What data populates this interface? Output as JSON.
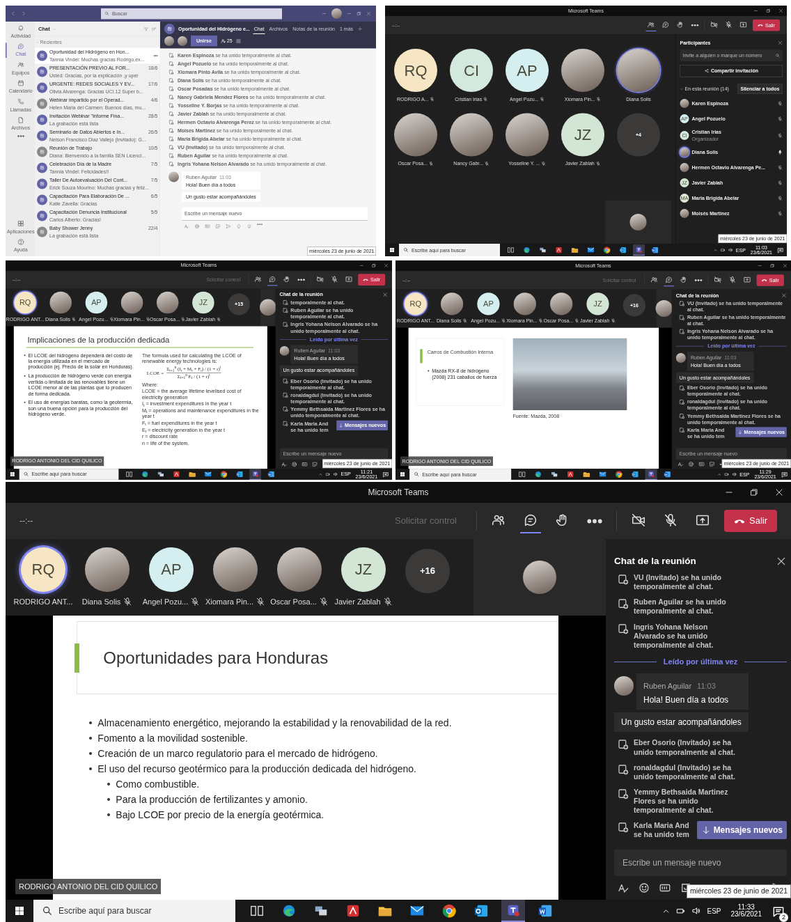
{
  "panels": [
    {
      "kind": "chat_app",
      "search_placeholder": "Buscar",
      "rail": [
        {
          "label": "Actividad",
          "selected": false
        },
        {
          "label": "Chat",
          "selected": true
        },
        {
          "label": "Equipos",
          "selected": false
        },
        {
          "label": "Calendario",
          "selected": false
        },
        {
          "label": "Llamadas",
          "selected": false
        },
        {
          "label": "Archivos",
          "selected": false
        },
        {
          "selected": false
        }
      ],
      "rail_bottom": [
        {
          "label": "Aplicaciones"
        },
        {
          "label": "Ayuda"
        }
      ],
      "list_title": "Chat",
      "section": "Recientes",
      "chats": [
        {
          "title": "Oportunidad del Hidrógeno en Hon...",
          "preview": "Tannia Vindel: Muchas gracias Rodrigo,ex...",
          "color": "#6264a7",
          "selected": true
        },
        {
          "title": "PRESENTACIÓN PREVIO AL FOR...",
          "date": "18/6",
          "preview": "Usted: Gracias, por la explicación ,y uper",
          "color": "#6264a7",
          "selected": false
        },
        {
          "title": "URGENTE: REDES SOCIALES Y EV...",
          "date": "17/6",
          "preview": "Olivia Alvarenga: Gracias UCI.12 Super b...",
          "color": "#6264a7",
          "selected": false
        },
        {
          "title": "Webinar impartido por el Operad...",
          "date": "4/6",
          "preview": "Helen Maria del Carmen: Buenos días, mu...",
          "color": "#8a8886",
          "selected": false
        },
        {
          "title": "Invitación Webinar \"Informe Fina...",
          "date": "28/5",
          "preview": "La grabación está lista",
          "color": "#6264a7",
          "selected": false
        },
        {
          "title": "Seminario de Datos Abiertos e In...",
          "date": "26/5",
          "preview": "Nelson Francisco Diaz Vallejo (Invitado): G...",
          "color": "#6264a7",
          "selected": false
        },
        {
          "title": "Reunión de Trabajo",
          "date": "10/5",
          "preview": "Diana: Bienvenido a la familia SEN Licenci...",
          "color": "#8a8886",
          "selected": false
        },
        {
          "title": "Celebración Día de la Madre",
          "date": "7/5",
          "preview": "Tannia Vindel: Felicidades!!",
          "color": "#6264a7",
          "selected": false
        },
        {
          "title": "Taller De Autoevaluación Del Cont...",
          "date": "7/5",
          "preview": "Erick Souza Mourino: Muchas gracias y feliz...",
          "color": "#6264a7",
          "selected": false
        },
        {
          "title": "Capacitación Para Elaboración De ...",
          "date": "6/5",
          "preview": "Katie Zavella: Gracias",
          "color": "#6264a7",
          "selected": false
        },
        {
          "title": "Capacitación Denuncia Institucional",
          "date": "5/5",
          "preview": "Carlos Alberto: Gracias!",
          "color": "#6264a7",
          "selected": false
        },
        {
          "title": "Baby Shower Jenny",
          "date": "22/4",
          "preview": "La grabación está lista",
          "color": "#8a8886",
          "selected": false
        }
      ],
      "conversation": {
        "title": "Oportunidad del Hidrógeno e...",
        "tabs": [
          {
            "label": "Chat",
            "selected": true
          },
          {
            "label": "Archivos",
            "selected": false
          },
          {
            "label": "Notas de la reunión",
            "selected": false
          },
          {
            "label": "1 más",
            "selected": false
          }
        ],
        "join_button": "Unirse",
        "participant_count": "25",
        "events": [
          "**Karen Espinoza** se ha unido temporalmente al chat.",
          "**Angel Pozuelo** se ha unido temporalmente al chat.",
          "**Xiomara Pinto Avila** se ha unido temporalmente al chat.",
          "**Diana Solis** se ha unido temporalmente al chat.",
          "**Oscar Posadas** se ha unido temporalmente al chat.",
          "**Nancy Gabriela Mendez Flores** se ha unido temporalmente al chat.",
          "**Yosseline Y. Borjas** se ha unido temporalmente al chat.",
          "**Javier Zablah** se ha unido temporalmente al chat.",
          "**Hermen Octavio Alvarenga Perez** se ha unido temporalmente al chat.",
          "**Moisés Martinez** se ha unido temporalmente al chat.",
          "**Maria Brigida Abelar** se ha unido temporalmente al chat.",
          "**VU (Invitado)** se ha unido temporalmente al chat.",
          "**Ruben Aguilar** se ha unido temporalmente al chat.",
          "**Ingris Yohana Nelson Alvarado** se ha unido temporalmente al chat."
        ],
        "message": {
          "author": "Ruben Aguilar",
          "time": "11:03",
          "texts": [
            "Hola! Buen día a todos",
            "Un gusto estar acompañándoles"
          ]
        },
        "compose_placeholder": "Escribe un mensaje nuevo"
      },
      "tooltip": "miércoles 23 de junio de 2021"
    },
    {
      "kind": "gallery",
      "title": "Microsoft Teams",
      "timer": "--:--",
      "toolbar": [
        {
          "kind": "participants",
          "selected": true
        },
        {
          "kind": "chat",
          "selected": false
        },
        {
          "kind": "reactions",
          "selected": false
        },
        {
          "kind": "more",
          "selected": false
        }
      ],
      "leave_button": "Salir",
      "tiles": [
        {
          "kind": "initials",
          "initials": "RQ",
          "color": "#f7e6c4",
          "name": "RODRIGO A...",
          "muted": true,
          "speaking": false
        },
        {
          "kind": "initials",
          "initials": "CI",
          "color": "#d3e9dd",
          "name": "Cristian Irias",
          "muted": true,
          "speaking": false
        },
        {
          "kind": "initials",
          "initials": "AP",
          "color": "#d5eff0",
          "name": "Angel Pozu...",
          "muted": true,
          "speaking": false
        },
        {
          "kind": "photo",
          "name": "Xiomara Pin...",
          "muted": true,
          "speaking": false
        },
        {
          "kind": "photo",
          "name": "Diana Solis",
          "muted": false,
          "speaking": true
        },
        {
          "kind": "photo",
          "name": "Oscar Posa...",
          "muted": true,
          "speaking": false
        },
        {
          "kind": "photo",
          "name": "Nancy Gabr...",
          "muted": true,
          "speaking": false
        },
        {
          "kind": "photo",
          "name": "Yosseline Y. ...",
          "muted": true,
          "speaking": false
        },
        {
          "kind": "initials",
          "initials": "JZ",
          "color": "#d3e6d6",
          "name": "Javier Zablah",
          "muted": true,
          "speaking": false
        },
        {
          "kind": "overflow",
          "label": "+4"
        }
      ],
      "participants": {
        "title": "Participantes",
        "search_placeholder": "Invite a alguien o marque un número",
        "share_button": "Compartir invitación",
        "section": "En esta reunión (14)",
        "mute_all": "Silenciar a todos",
        "people": [
          {
            "kind": "photo",
            "name": "Karen Espinoza",
            "muted": true,
            "speaking": false
          },
          {
            "kind": "initials",
            "initials": "AP",
            "color": "#d5eff0",
            "name": "Angel Pozuelo",
            "muted": true,
            "speaking": false
          },
          {
            "kind": "initials",
            "initials": "CI",
            "color": "#d3e9dd",
            "name": "Cristian Irias",
            "role": "Organizador",
            "muted": true,
            "speaking": false
          },
          {
            "kind": "photo",
            "name": "Diana Solis",
            "muted": false,
            "speaking": true
          },
          {
            "kind": "photo",
            "name": "Hermen Octavio Alvarenga Pe...",
            "muted": true,
            "speaking": false
          },
          {
            "kind": "initials",
            "initials": "JZ",
            "color": "#d3e6d6",
            "name": "Javier Zablah",
            "muted": true,
            "speaking": false
          },
          {
            "kind": "initials",
            "initials": "MA",
            "color": "#dfe8d4",
            "name": "Maria Brigida Abelar",
            "muted": true,
            "speaking": false
          },
          {
            "kind": "photo",
            "name": "Moisés Martinez",
            "muted": true,
            "speaking": false
          }
        ]
      },
      "tooltip": "miércoles 23 de junio de 2021",
      "taskbar": {
        "search_placeholder": "Escribe aquí para buscar",
        "language": "ESP",
        "time": "11:03",
        "date": "23/6/2021"
      }
    },
    {
      "kind": "presentation",
      "title": "Microsoft Teams",
      "timer": "--:--",
      "request_control": "Solicitar control",
      "toolbar": [
        {
          "kind": "participants",
          "selected": false
        },
        {
          "kind": "chat",
          "selected": true
        },
        {
          "kind": "reactions",
          "selected": false
        },
        {
          "kind": "more",
          "selected": false
        }
      ],
      "leave_button": "Salir",
      "strip": [
        {
          "kind": "initials",
          "initials": "RQ",
          "color": "#f7e6c4",
          "name": "RODRIGO ANT...",
          "muted": false,
          "speaking": true
        },
        {
          "kind": "photo",
          "name": "Diana Solis",
          "muted": true,
          "speaking": false
        },
        {
          "kind": "initials",
          "initials": "AP",
          "color": "#d5eff0",
          "name": "Angel Pozu...",
          "muted": true,
          "speaking": false
        },
        {
          "kind": "photo",
          "name": "Xiomara Pin...",
          "muted": true,
          "speaking": false
        },
        {
          "kind": "photo",
          "name": "Oscar Posa...",
          "muted": true,
          "speaking": false
        },
        {
          "kind": "initials",
          "initials": "JZ",
          "color": "#d3e6d6",
          "name": "Javier Zablah",
          "muted": true,
          "speaking": false
        },
        {
          "kind": "overflow",
          "label": "+15"
        }
      ],
      "slide": {
        "kind": "formula",
        "title": "Implicaciones de la producción dedicada",
        "bullets": [
          {
            "text": "El LCOE del hidrógeno dependerá del costo de la energía utilizada en el mercado de producción (ej. Precio de la solar en Honduras)."
          },
          {
            "text": "La producción de hidrógeno verde con energía vertida o limitada de las renovables tiene un LCOE menor al de las plantas que lo producen de forma dedicada."
          },
          {
            "text": "El uso de energías baratas, como la geotermia, son una buena opción para la producción del hidrógeno verde."
          }
        ],
        "formula": {
          "intro": "The formula used for calculating the LCOE of renewable energy technologies is:",
          "lhs": "LCOE =",
          "numerator": "Σ$_{t=1}$$^{n}$ (I$_{t}$ + M$_{t}$ + F$_{t}$) / (1 + r)$^{t}$",
          "denominator": "Σ$_{t=1}$$^{n}$ E$_{t}$ / (1 + r)$^{t}$",
          "where": "Where:",
          "definitions": [
            "LCOE = the average lifetime levelised cost of electricity generation",
            "I$_{t}$ = investment expenditures in the year t",
            "M$_{t}$ = operations and maintenance expenditures in the year t",
            "F$_{t}$ = fuel expenditures in the year t",
            "E$_{t}$ = electricity generation in the year t",
            "r = discount rate",
            "n = life of the system."
          ]
        }
      },
      "presenter": "RODRIGO ANTONIO DEL CID QUILICO",
      "chat": {
        "title": "Chat de la reunión",
        "items": [
          {
            "kind": "system",
            "text": "temporalmente al chat."
          },
          {
            "kind": "system",
            "text": "Ruben Aguilar se ha unido temporalmente al chat."
          },
          {
            "kind": "system",
            "text": "Ingris Yohana Nelson Alvarado se ha unido temporalmente al chat."
          },
          {
            "kind": "divider",
            "text": "Leído por última vez"
          },
          {
            "kind": "message",
            "author": "Ruben Aguilar",
            "time": "11:03",
            "texts": [
              "Hola! Buen día a todos",
              "Un gusto estar acompañándoles"
            ]
          },
          {
            "kind": "system",
            "text": "Eber Osorio (Invitado) se ha unido temporalmente al chat."
          },
          {
            "kind": "system",
            "text": "ronaldagdul (Invitado) se ha unido temporalmente al chat."
          },
          {
            "kind": "system",
            "text": "Yemmy Bethsaida Martinez Flores se ha unido temporalmente al chat."
          },
          {
            "kind": "system",
            "text": "Karla Maria And se ha unido tem"
          }
        ],
        "new_messages": "Mensajes nuevos",
        "compose_placeholder": "Escribe un mensaje nuevo"
      },
      "tooltip": "miércoles 23 de junio de 2021",
      "taskbar": {
        "search_placeholder": "Escribe aquí para buscar",
        "language": "ESP",
        "time": "11:21",
        "date": "23/6/2021"
      }
    },
    {
      "kind": "presentation",
      "title": "Microsoft Teams",
      "timer": "--:--",
      "request_control": "Solicitar control",
      "toolbar": [
        {
          "kind": "participants",
          "selected": false
        },
        {
          "kind": "chat",
          "selected": true
        },
        {
          "kind": "reactions",
          "selected": false
        },
        {
          "kind": "more",
          "selected": false
        }
      ],
      "leave_button": "Salir",
      "strip": [
        {
          "kind": "initials",
          "initials": "RQ",
          "color": "#f7e6c4",
          "name": "RODRIGO ANT...",
          "muted": false,
          "speaking": true
        },
        {
          "kind": "photo",
          "name": "Diana Solis",
          "muted": true,
          "speaking": false
        },
        {
          "kind": "initials",
          "initials": "AP",
          "color": "#d5eff0",
          "name": "Angel Pozu...",
          "muted": true,
          "speaking": false
        },
        {
          "kind": "photo",
          "name": "Xiomara Pin...",
          "muted": true,
          "speaking": false
        },
        {
          "kind": "photo",
          "name": "Oscar Posa...",
          "muted": true,
          "speaking": false
        },
        {
          "kind": "initials",
          "initials": "JZ",
          "color": "#d3e6d6",
          "name": "Javier Zablah",
          "muted": true,
          "speaking": false
        },
        {
          "kind": "overflow",
          "label": "+16"
        }
      ],
      "slide": {
        "kind": "photo",
        "title": "Carros de Combustión Interna",
        "bullets": [
          {
            "text": "Mazda RX-8 de hidrógeno (2008) 231 caballos de fuerza"
          }
        ],
        "caption": "Fuente: Mazda, 2008"
      },
      "presenter": "RODRIGO ANTONIO DEL CID QUILICO",
      "chat": {
        "title": "Chat de la reunión",
        "items": [
          {
            "kind": "system",
            "text": "VU (Invitado) se ha unido temporalmente al chat."
          },
          {
            "kind": "system",
            "text": "Ruben Aguilar se ha unido temporalmente al chat."
          },
          {
            "kind": "system",
            "text": "Ingris Yohana Nelson Alvarado se ha unido temporalmente al chat."
          },
          {
            "kind": "divider",
            "text": "Leído por última vez"
          },
          {
            "kind": "message",
            "author": "Ruben Aguilar",
            "time": "11:03",
            "texts": [
              "Hola! Buen día a todos",
              "Un gusto estar acompañándoles"
            ]
          },
          {
            "kind": "system",
            "text": "Eber Osorio (Invitado) se ha unido temporalmente al chat."
          },
          {
            "kind": "system",
            "text": "ronaldagdul (Invitado) se ha unido temporalmente al chat."
          },
          {
            "kind": "system",
            "text": "Yemmy Bethsaida Martinez Flores se ha unido temporalmente al chat."
          },
          {
            "kind": "system",
            "text": "Karla Maria And se ha unido tem"
          }
        ],
        "new_messages": "Mensajes nuevos",
        "compose_placeholder": "Escribe un mensaje nuevo"
      },
      "tooltip": "miércoles 23 de junio de 2021",
      "taskbar": {
        "search_placeholder": "Escribe aquí para buscar",
        "language": "ESP",
        "time": "11:29",
        "date": "23/6/2021"
      }
    },
    {
      "kind": "presentation",
      "title": "Microsoft Teams",
      "timer": "--:--",
      "request_control": "Solicitar control",
      "toolbar": [
        {
          "kind": "participants",
          "selected": false
        },
        {
          "kind": "chat",
          "selected": true
        },
        {
          "kind": "reactions",
          "selected": false
        },
        {
          "kind": "more",
          "selected": false
        }
      ],
      "leave_button": "Salir",
      "strip": [
        {
          "kind": "initials",
          "initials": "RQ",
          "color": "#f7e6c4",
          "name": "RODRIGO ANT...",
          "muted": false,
          "speaking": true
        },
        {
          "kind": "photo",
          "name": "Diana Solis",
          "muted": true,
          "speaking": false
        },
        {
          "kind": "initials",
          "initials": "AP",
          "color": "#d5eff0",
          "name": "Angel Pozu...",
          "muted": true,
          "speaking": false
        },
        {
          "kind": "photo",
          "name": "Xiomara Pin...",
          "muted": true,
          "speaking": false
        },
        {
          "kind": "photo",
          "name": "Oscar Posa...",
          "muted": true,
          "speaking": false
        },
        {
          "kind": "initials",
          "initials": "JZ",
          "color": "#d3e6d6",
          "name": "Javier Zablah",
          "muted": true,
          "speaking": false
        },
        {
          "kind": "overflow",
          "label": "+16"
        }
      ],
      "slide": {
        "kind": "boxed",
        "title": "Oportunidades para Honduras",
        "bullets": [
          {
            "text": "Almacenamiento energético, mejorando la estabilidad y la renovabilidad de la red."
          },
          {
            "text": "Fomento a la movilidad sostenible."
          },
          {
            "text": "Creación de un marco regulatorio para el mercado de hidrógeno."
          },
          {
            "text": "El uso del recurso geotérmico para la producción dedicada del hidrógeno.",
            "children": [
              {
                "text": "Como combustible."
              },
              {
                "text": "Para la producción de fertilizantes y amonio."
              },
              {
                "text": "Bajo LCOE por precio de la energía geotérmica."
              }
            ]
          }
        ]
      },
      "presenter": "RODRIGO ANTONIO DEL CID QUILICO",
      "chat": {
        "title": "Chat de la reunión",
        "items": [
          {
            "kind": "system",
            "text": "VU (Invitado) se ha unido temporalmente al chat."
          },
          {
            "kind": "system",
            "text": "Ruben Aguilar se ha unido temporalmente al chat."
          },
          {
            "kind": "system",
            "text": "Ingris Yohana Nelson Alvarado se ha unido temporalmente al chat."
          },
          {
            "kind": "divider",
            "text": "Leído por última vez"
          },
          {
            "kind": "message",
            "author": "Ruben Aguilar",
            "time": "11:03",
            "texts": [
              "Hola! Buen día a todos",
              "Un gusto estar acompañándoles"
            ]
          },
          {
            "kind": "system",
            "text": "Eber Osorio (Invitado) se ha unido temporalmente al chat."
          },
          {
            "kind": "system",
            "text": "ronaldagdul (Invitado) se ha unido temporalmente al chat."
          },
          {
            "kind": "system",
            "text": "Yemmy Bethsaida Martinez Flores se ha unido temporalmente al chat."
          },
          {
            "kind": "system",
            "text": "Karla Maria And se ha unido tem"
          }
        ],
        "new_messages": "Mensajes nuevos",
        "compose_placeholder": "Escribe un mensaje nuevo"
      },
      "tooltip": "miércoles 23 de junio de 2021",
      "taskbar": {
        "search_placeholder": "Escribe aquí para buscar",
        "language": "ESP",
        "time": "11:33",
        "date": "23/6/2021",
        "notifications": "2"
      }
    }
  ]
}
